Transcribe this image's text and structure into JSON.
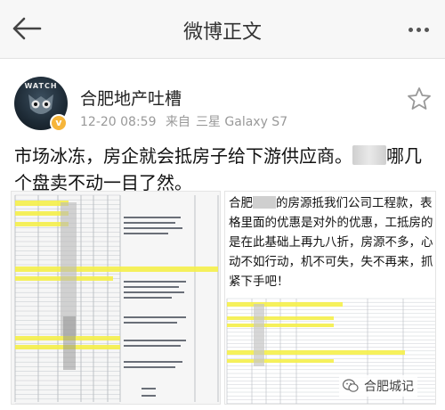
{
  "nav": {
    "title": "微博正文",
    "back_icon": "arrow-left-icon",
    "more_icon": "more-dots-icon"
  },
  "post": {
    "avatar_text": "WATCH",
    "badge": "v",
    "username": "合肥地产吐槽",
    "time": "12-20 08:59",
    "source_prefix": "来自",
    "source": "三星 Galaxy S7",
    "text_a": "市场冰冻，房企就会抵房子给下游供应商。",
    "text_b": "哪几个盘卖不动一目了然。"
  },
  "image_right": {
    "caption_a": "合肥",
    "caption_b": "的房源抵我们公司工程款，表格里面的优惠是对外的优惠，工抵房的是在此基础上再九八折，房源不多，心动不如行动，机不可失，失不再来，抓紧下手吧！"
  },
  "watermark": {
    "text": "合肥城记"
  },
  "colors": {
    "highlight": "#f5f04a",
    "accent": "#f6b53a"
  }
}
